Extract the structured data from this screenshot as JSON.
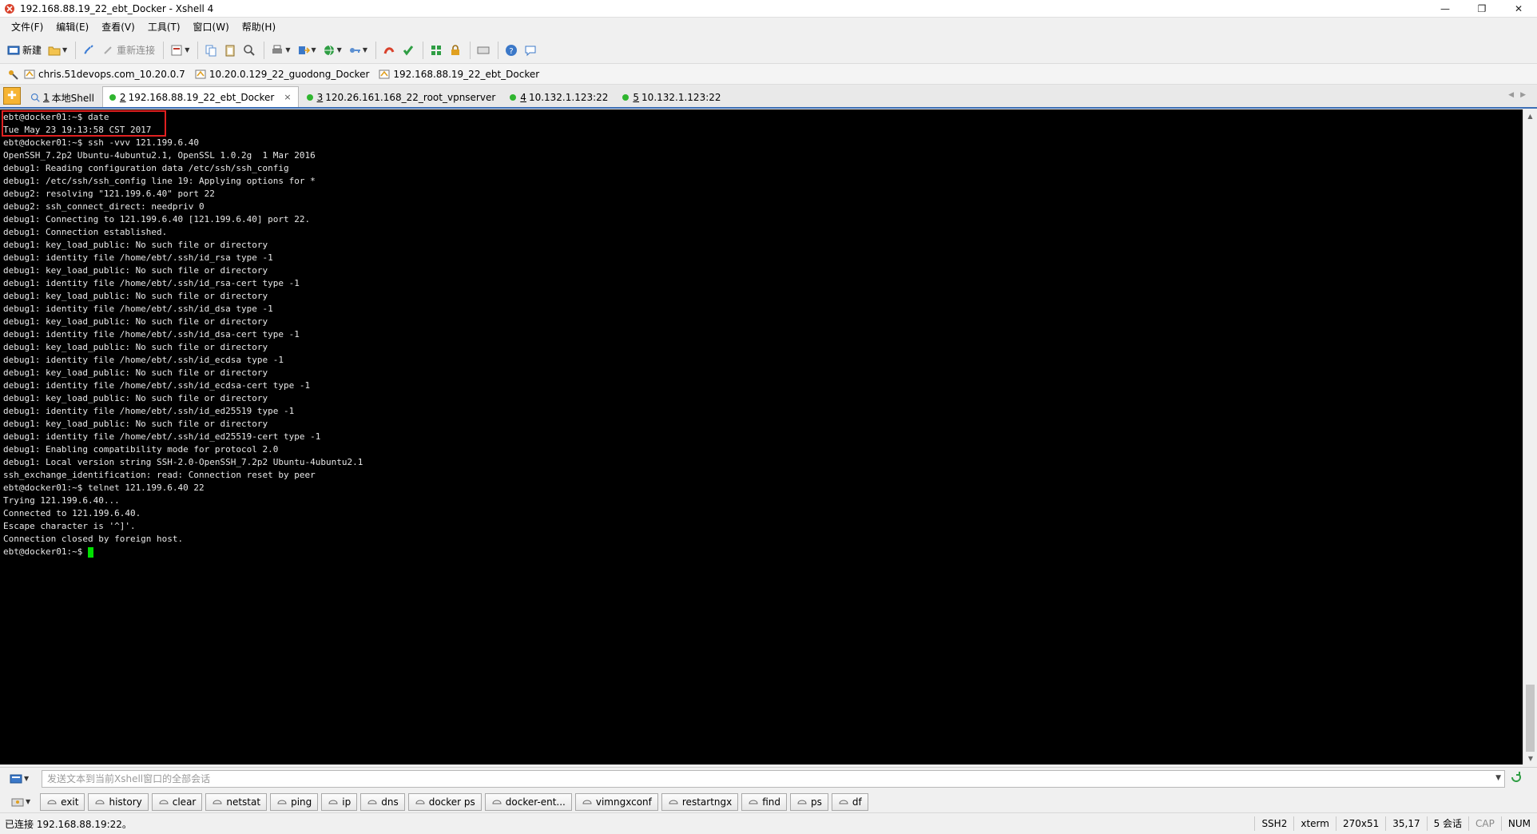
{
  "window": {
    "title": "192.168.88.19_22_ebt_Docker - Xshell 4",
    "minimize": "—",
    "restore": "❐",
    "close": "✕"
  },
  "menu": [
    {
      "label": "文件(F)"
    },
    {
      "label": "编辑(E)"
    },
    {
      "label": "查看(V)"
    },
    {
      "label": "工具(T)"
    },
    {
      "label": "窗口(W)"
    },
    {
      "label": "帮助(H)"
    }
  ],
  "toolbar": {
    "new_label": "新建",
    "reconnect_label": "重新连接"
  },
  "links": [
    {
      "label": "chris.51devops.com_10.20.0.7"
    },
    {
      "label": "10.20.0.129_22_guodong_Docker"
    },
    {
      "label": "192.168.88.19_22_ebt_Docker"
    }
  ],
  "tabs": [
    {
      "num": "1",
      "label": "本地Shell"
    },
    {
      "num": "2",
      "label": "192.168.88.19_22_ebt_Docker",
      "close": "×"
    },
    {
      "num": "3",
      "label": "120.26.161.168_22_root_vpnserver"
    },
    {
      "num": "4",
      "label": "10.132.1.123:22"
    },
    {
      "num": "5",
      "label": "10.132.1.123:22"
    }
  ],
  "terminal": {
    "lines": [
      "ebt@docker01:~$ date",
      "Tue May 23 19:13:58 CST 2017",
      "ebt@docker01:~$ ssh -vvv 121.199.6.40",
      "OpenSSH_7.2p2 Ubuntu-4ubuntu2.1, OpenSSL 1.0.2g  1 Mar 2016",
      "debug1: Reading configuration data /etc/ssh/ssh_config",
      "debug1: /etc/ssh/ssh_config line 19: Applying options for *",
      "debug2: resolving \"121.199.6.40\" port 22",
      "debug2: ssh_connect_direct: needpriv 0",
      "debug1: Connecting to 121.199.6.40 [121.199.6.40] port 22.",
      "debug1: Connection established.",
      "debug1: key_load_public: No such file or directory",
      "debug1: identity file /home/ebt/.ssh/id_rsa type -1",
      "debug1: key_load_public: No such file or directory",
      "debug1: identity file /home/ebt/.ssh/id_rsa-cert type -1",
      "debug1: key_load_public: No such file or directory",
      "debug1: identity file /home/ebt/.ssh/id_dsa type -1",
      "debug1: key_load_public: No such file or directory",
      "debug1: identity file /home/ebt/.ssh/id_dsa-cert type -1",
      "debug1: key_load_public: No such file or directory",
      "debug1: identity file /home/ebt/.ssh/id_ecdsa type -1",
      "debug1: key_load_public: No such file or directory",
      "debug1: identity file /home/ebt/.ssh/id_ecdsa-cert type -1",
      "debug1: key_load_public: No such file or directory",
      "debug1: identity file /home/ebt/.ssh/id_ed25519 type -1",
      "debug1: key_load_public: No such file or directory",
      "debug1: identity file /home/ebt/.ssh/id_ed25519-cert type -1",
      "debug1: Enabling compatibility mode for protocol 2.0",
      "debug1: Local version string SSH-2.0-OpenSSH_7.2p2 Ubuntu-4ubuntu2.1",
      "ssh_exchange_identification: read: Connection reset by peer",
      "ebt@docker01:~$ telnet 121.199.6.40 22",
      "Trying 121.199.6.40...",
      "Connected to 121.199.6.40.",
      "Escape character is '^]'.",
      "Connection closed by foreign host."
    ],
    "prompt": "ebt@docker01:~$ "
  },
  "compose": {
    "placeholder": "发送文本到当前Xshell窗口的全部会话"
  },
  "quick_commands": [
    {
      "label": "exit"
    },
    {
      "label": "history"
    },
    {
      "label": "clear"
    },
    {
      "label": "netstat"
    },
    {
      "label": "ping"
    },
    {
      "label": "ip"
    },
    {
      "label": "dns"
    },
    {
      "label": "docker ps"
    },
    {
      "label": "docker-ent..."
    },
    {
      "label": "vimngxconf"
    },
    {
      "label": "restartngx"
    },
    {
      "label": "find"
    },
    {
      "label": "ps"
    },
    {
      "label": "df"
    }
  ],
  "status": {
    "connection": "已连接 192.168.88.19:22。",
    "protocol": "SSH2",
    "terminal_type": "xterm",
    "size": "270x51",
    "cursor_pos": "35,17",
    "sessions": "5 会话",
    "cap": "CAP",
    "num": "NUM"
  },
  "colors": {
    "terminal_bg": "#000000",
    "terminal_fg": "#e8e8e8",
    "cursor": "#00e000",
    "highlight": "#e02020",
    "tab_active_dot": "#2fb52f"
  }
}
